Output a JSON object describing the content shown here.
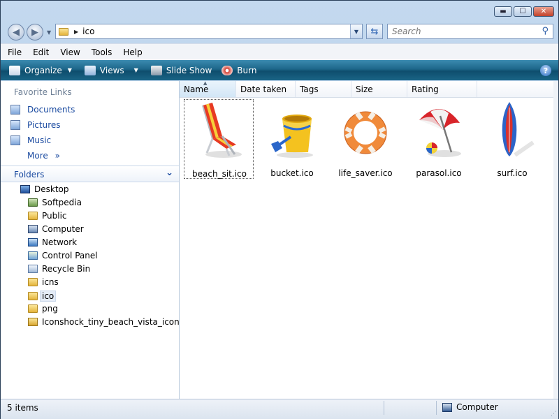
{
  "window": {
    "buttons": {
      "minimize": "▬",
      "maximize": "☐",
      "close": "✕"
    }
  },
  "nav": {
    "back_icon": "back-arrow-icon",
    "forward_icon": "forward-arrow-icon",
    "address_path": "ico",
    "search_placeholder": "Search"
  },
  "menu": [
    "File",
    "Edit",
    "View",
    "Tools",
    "Help"
  ],
  "commands": {
    "organize": "Organize",
    "views": "Views",
    "slideshow": "Slide Show",
    "burn": "Burn"
  },
  "favorites": {
    "title": "Favorite Links",
    "items": [
      "Documents",
      "Pictures",
      "Music"
    ],
    "more": "More",
    "more_glyph": "»"
  },
  "folders": {
    "title": "Folders",
    "tree": [
      {
        "label": "Desktop",
        "icon": "desktop-icon"
      },
      {
        "label": "Softpedia",
        "icon": "folder-icon"
      },
      {
        "label": "Public",
        "icon": "folder-icon"
      },
      {
        "label": "Computer",
        "icon": "computer-icon"
      },
      {
        "label": "Network",
        "icon": "network-icon"
      },
      {
        "label": "Control Panel",
        "icon": "control-panel-icon"
      },
      {
        "label": "Recycle Bin",
        "icon": "recycle-bin-icon"
      },
      {
        "label": "icns",
        "icon": "folder-icon"
      },
      {
        "label": "ico",
        "icon": "folder-icon",
        "selected": true
      },
      {
        "label": "png",
        "icon": "folder-icon"
      },
      {
        "label": "Iconshock_tiny_beach_vista_icons.zip",
        "icon": "zip-folder-icon"
      }
    ]
  },
  "columns": [
    "Name",
    "Date taken",
    "Tags",
    "Size",
    "Rating"
  ],
  "files": [
    {
      "name": "beach_sit.ico",
      "icon": "beach-chair-icon"
    },
    {
      "name": "bucket.ico",
      "icon": "bucket-icon"
    },
    {
      "name": "life_saver.ico",
      "icon": "life-saver-icon"
    },
    {
      "name": "parasol.ico",
      "icon": "parasol-icon"
    },
    {
      "name": "surf.ico",
      "icon": "surfboard-icon"
    }
  ],
  "status": {
    "count": "5 items",
    "zone": "Computer"
  },
  "colors": {
    "command_bar": "#1d6689",
    "link_blue": "#1a4aa0"
  }
}
